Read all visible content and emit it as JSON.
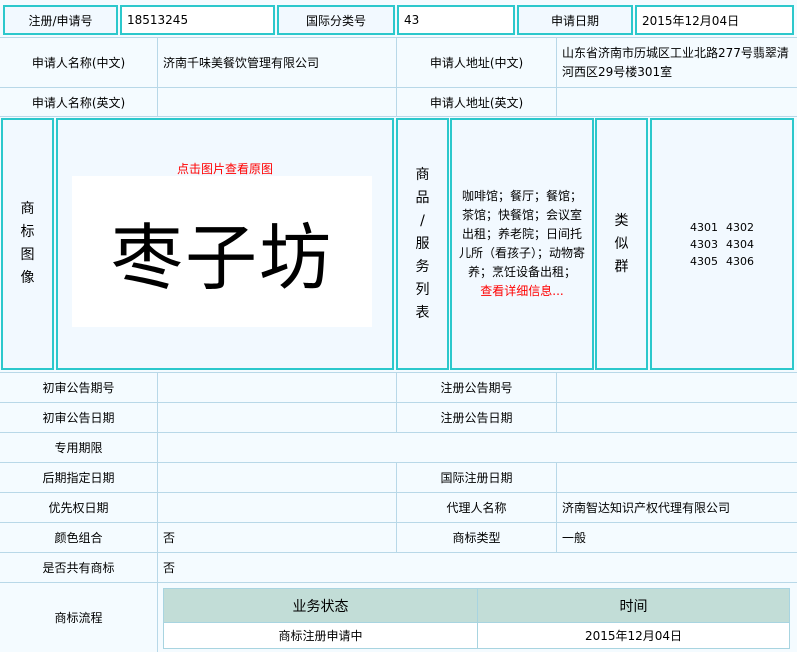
{
  "top": {
    "reg_label": "注册/申请号",
    "reg_value": "18513245",
    "class_label": "国际分类号",
    "class_value": "43",
    "date_label": "申请日期",
    "date_value": "2015年12月04日"
  },
  "applicant": {
    "name_cn_label": "申请人名称(中文)",
    "name_cn": "济南千味美餐饮管理有限公司",
    "addr_cn_label": "申请人地址(中文)",
    "addr_cn": "山东省济南市历城区工业北路277号翡翠清河西区29号楼301室",
    "name_en_label": "申请人名称(英文)",
    "name_en": "",
    "addr_en_label": "申请人地址(英文)",
    "addr_en": ""
  },
  "mark": {
    "label": [
      "商",
      "标",
      "图",
      "像"
    ],
    "view_link": "点击图片查看原图",
    "image_text": "枣子坊"
  },
  "goods": {
    "label": [
      "商",
      "品",
      "/",
      "服",
      "务",
      "列",
      "表"
    ],
    "text": "咖啡馆；餐厅；餐馆；茶馆；快餐馆；会议室出租；养老院；日间托儿所（看孩子）；动物寄养；烹饪设备出租；",
    "more_link": "查看详细信息..."
  },
  "similar": {
    "label": [
      "类",
      "似",
      "群"
    ],
    "groups": [
      "4301",
      "4302",
      "4303",
      "4304",
      "4305",
      "4306"
    ]
  },
  "rows": [
    {
      "l1": "初审公告期号",
      "v1": "",
      "l2": "注册公告期号",
      "v2": ""
    },
    {
      "l1": "初审公告日期",
      "v1": "",
      "l2": "注册公告日期",
      "v2": ""
    },
    {
      "l1": "专用期限",
      "v1": ""
    },
    {
      "l1": "后期指定日期",
      "v1": "",
      "l2": "国际注册日期",
      "v2": ""
    },
    {
      "l1": "优先权日期",
      "v1": "",
      "l2": "代理人名称",
      "v2": "济南智达知识产权代理有限公司"
    },
    {
      "l1": "颜色组合",
      "v1": "否",
      "l2": "商标类型",
      "v2": "一般"
    },
    {
      "l1": "是否共有商标",
      "v1": "否"
    }
  ],
  "flow": {
    "label": "商标流程",
    "headers": [
      "业务状态",
      "时间"
    ],
    "rows": [
      [
        "商标注册申请中",
        "2015年12月04日"
      ]
    ]
  }
}
